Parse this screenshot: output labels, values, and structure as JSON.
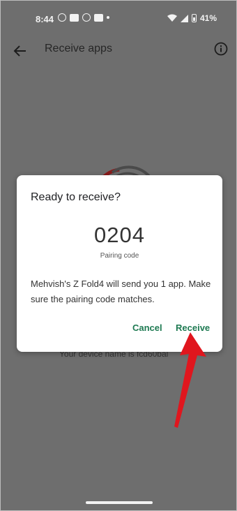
{
  "status_bar": {
    "time": "8:44",
    "battery": "41%",
    "notification_icons": [
      "whatsapp-icon",
      "mail-icon",
      "snapchat-icon",
      "app-icon"
    ]
  },
  "app_bar": {
    "title": "Receive apps",
    "back_icon": "arrow-left-icon",
    "info_icon": "info-icon"
  },
  "background": {
    "device_name": "Your device name is fcd60bal"
  },
  "dialog": {
    "title": "Ready to receive?",
    "pairing_code": "0204",
    "pairing_label": "Pairing code",
    "message": "Mehvish's Z Fold4 will send you 1 app. Make sure the pairing code matches.",
    "cancel_label": "Cancel",
    "receive_label": "Receive"
  },
  "colors": {
    "scrim": "#6e6e6e",
    "accent": "#1e7a52",
    "annotation_arrow": "#e0161e"
  }
}
